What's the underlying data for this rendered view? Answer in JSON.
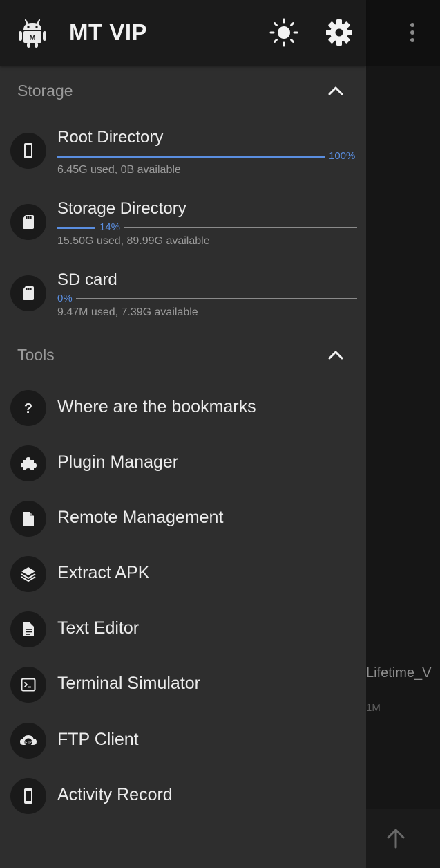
{
  "app": {
    "title": "MT VIP"
  },
  "background": {
    "file_name": "Lifetime_V",
    "file_size": "1M"
  },
  "storage": {
    "title": "Storage",
    "items": [
      {
        "name": "Root Directory",
        "percent_label": "100%",
        "usage": "6.45G used, 0B available",
        "percent": 100,
        "icon": "phone-icon"
      },
      {
        "name": "Storage Directory",
        "percent_label": "14%",
        "usage": "15.50G used, 89.99G available",
        "percent": 14,
        "icon": "sd-card-icon"
      },
      {
        "name": "SD card",
        "percent_label": "0%",
        "usage": "9.47M used, 7.39G available",
        "percent": 0,
        "icon": "sd-card-icon"
      }
    ]
  },
  "tools": {
    "title": "Tools",
    "items": [
      {
        "label": "Where are the bookmarks",
        "icon": "question-icon"
      },
      {
        "label": "Plugin Manager",
        "icon": "puzzle-icon"
      },
      {
        "label": "Remote Management",
        "icon": "file-icon"
      },
      {
        "label": "Extract APK",
        "icon": "layers-icon"
      },
      {
        "label": "Text Editor",
        "icon": "document-icon"
      },
      {
        "label": "Terminal Simulator",
        "icon": "terminal-icon"
      },
      {
        "label": "FTP Client",
        "icon": "ftp-cloud-icon"
      },
      {
        "label": "Activity Record",
        "icon": "phone-icon"
      }
    ]
  },
  "colors": {
    "accent": "#5a8ee0",
    "drawer_bg": "#2e2e2e",
    "header_bg": "#1b1b1b",
    "icon_circle": "#1a1a1a",
    "text_primary": "#ececec",
    "text_secondary": "#9b9b9b"
  }
}
